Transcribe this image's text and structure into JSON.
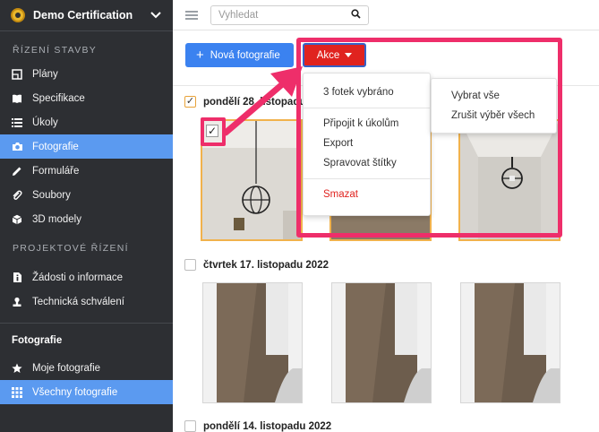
{
  "sidebar": {
    "project_name": "Demo Certification",
    "section_construction": "ŘÍZENÍ STAVBY",
    "items_construction": [
      {
        "label": "Plány",
        "icon": "map-icon"
      },
      {
        "label": "Specifikace",
        "icon": "book-icon"
      },
      {
        "label": "Úkoly",
        "icon": "list-icon"
      },
      {
        "label": "Fotografie",
        "icon": "camera-icon",
        "active": true
      },
      {
        "label": "Formuláře",
        "icon": "pencil-icon"
      },
      {
        "label": "Soubory",
        "icon": "paperclip-icon"
      },
      {
        "label": "3D modely",
        "icon": "cube-icon"
      }
    ],
    "section_project": "PROJEKTOVÉ ŘÍZENÍ",
    "items_project": [
      {
        "label": "Žádosti o informace",
        "icon": "info-document-icon"
      },
      {
        "label": "Technická schválení",
        "icon": "person-stamp-icon"
      }
    ],
    "section_photos": "Fotografie",
    "items_photos": [
      {
        "label": "Moje fotografie",
        "icon": "star-icon"
      },
      {
        "label": "Všechny fotografie",
        "icon": "grid-icon",
        "active": true
      }
    ],
    "active_color": "#5b9af0"
  },
  "topbar": {
    "search_placeholder": "Vyhledat"
  },
  "toolbar": {
    "new_photo_label": "Nová fotografie",
    "actions_label": "Akce",
    "new_color": "#3b82f0",
    "actions_color": "#e0231f"
  },
  "groups": [
    {
      "date": "pondělí 28. listopadu",
      "checked": true
    },
    {
      "date": "čtvrtek 17. listopadu 2022",
      "checked": false
    },
    {
      "date": "pondělí 14. listopadu 2022",
      "checked": false
    }
  ],
  "dropdown": {
    "selected_count": "3 fotek vybráno",
    "link_tasks": "Připojit k úkolům",
    "export": "Export",
    "manage_tags": "Spravovat štítky",
    "delete": "Smazat"
  },
  "submenu": {
    "select_all": "Vybrat vše",
    "deselect_all": "Zrušit výběr všech"
  },
  "highlight_color": "#ee2e6a"
}
